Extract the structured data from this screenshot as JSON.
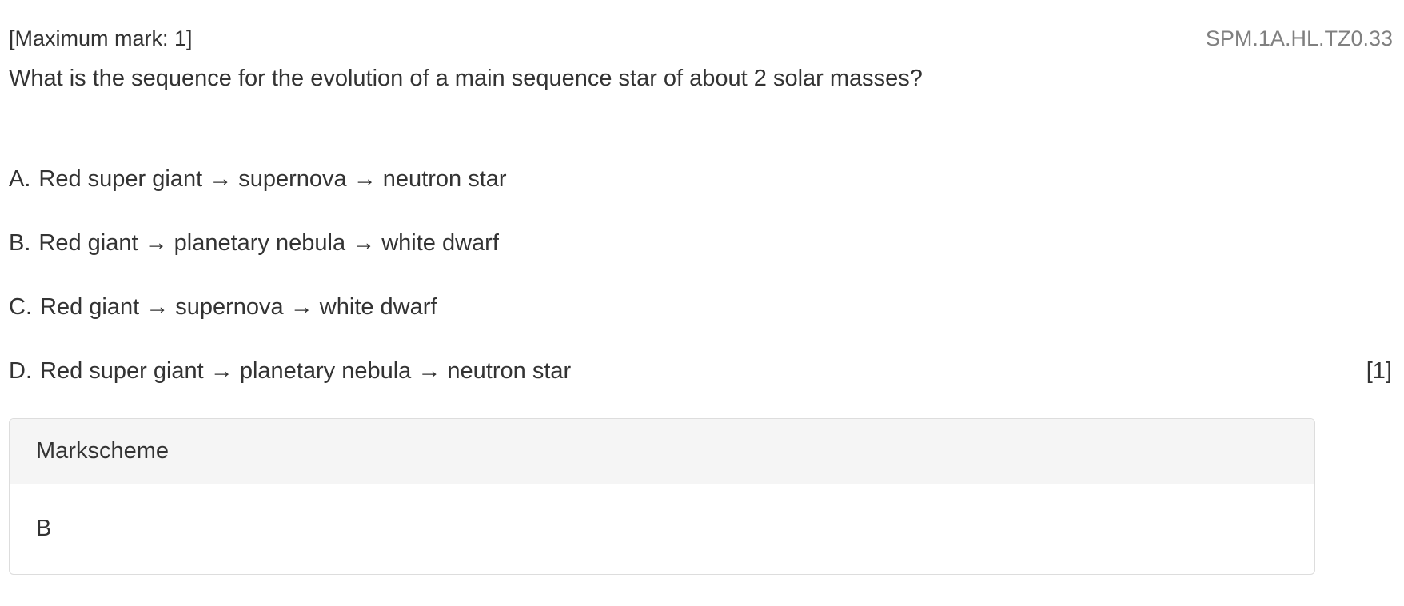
{
  "header": {
    "max_mark": "[Maximum mark: 1]",
    "reference": "SPM.1A.HL.TZ0.33"
  },
  "question": {
    "text": "What is the sequence for the evolution of a main sequence star of about 2 solar masses?",
    "options": [
      {
        "letter": "A.",
        "text": "Red super giant → supernova → neutron star"
      },
      {
        "letter": "B.",
        "text": "Red giant → planetary nebula → white dwarf"
      },
      {
        "letter": "C.",
        "text": "Red giant → supernova → white dwarf"
      },
      {
        "letter": "D.",
        "text": "Red super giant → planetary nebula → neutron star"
      }
    ],
    "mark_total": "[1]"
  },
  "markscheme": {
    "title": "Markscheme",
    "answer": "B"
  }
}
